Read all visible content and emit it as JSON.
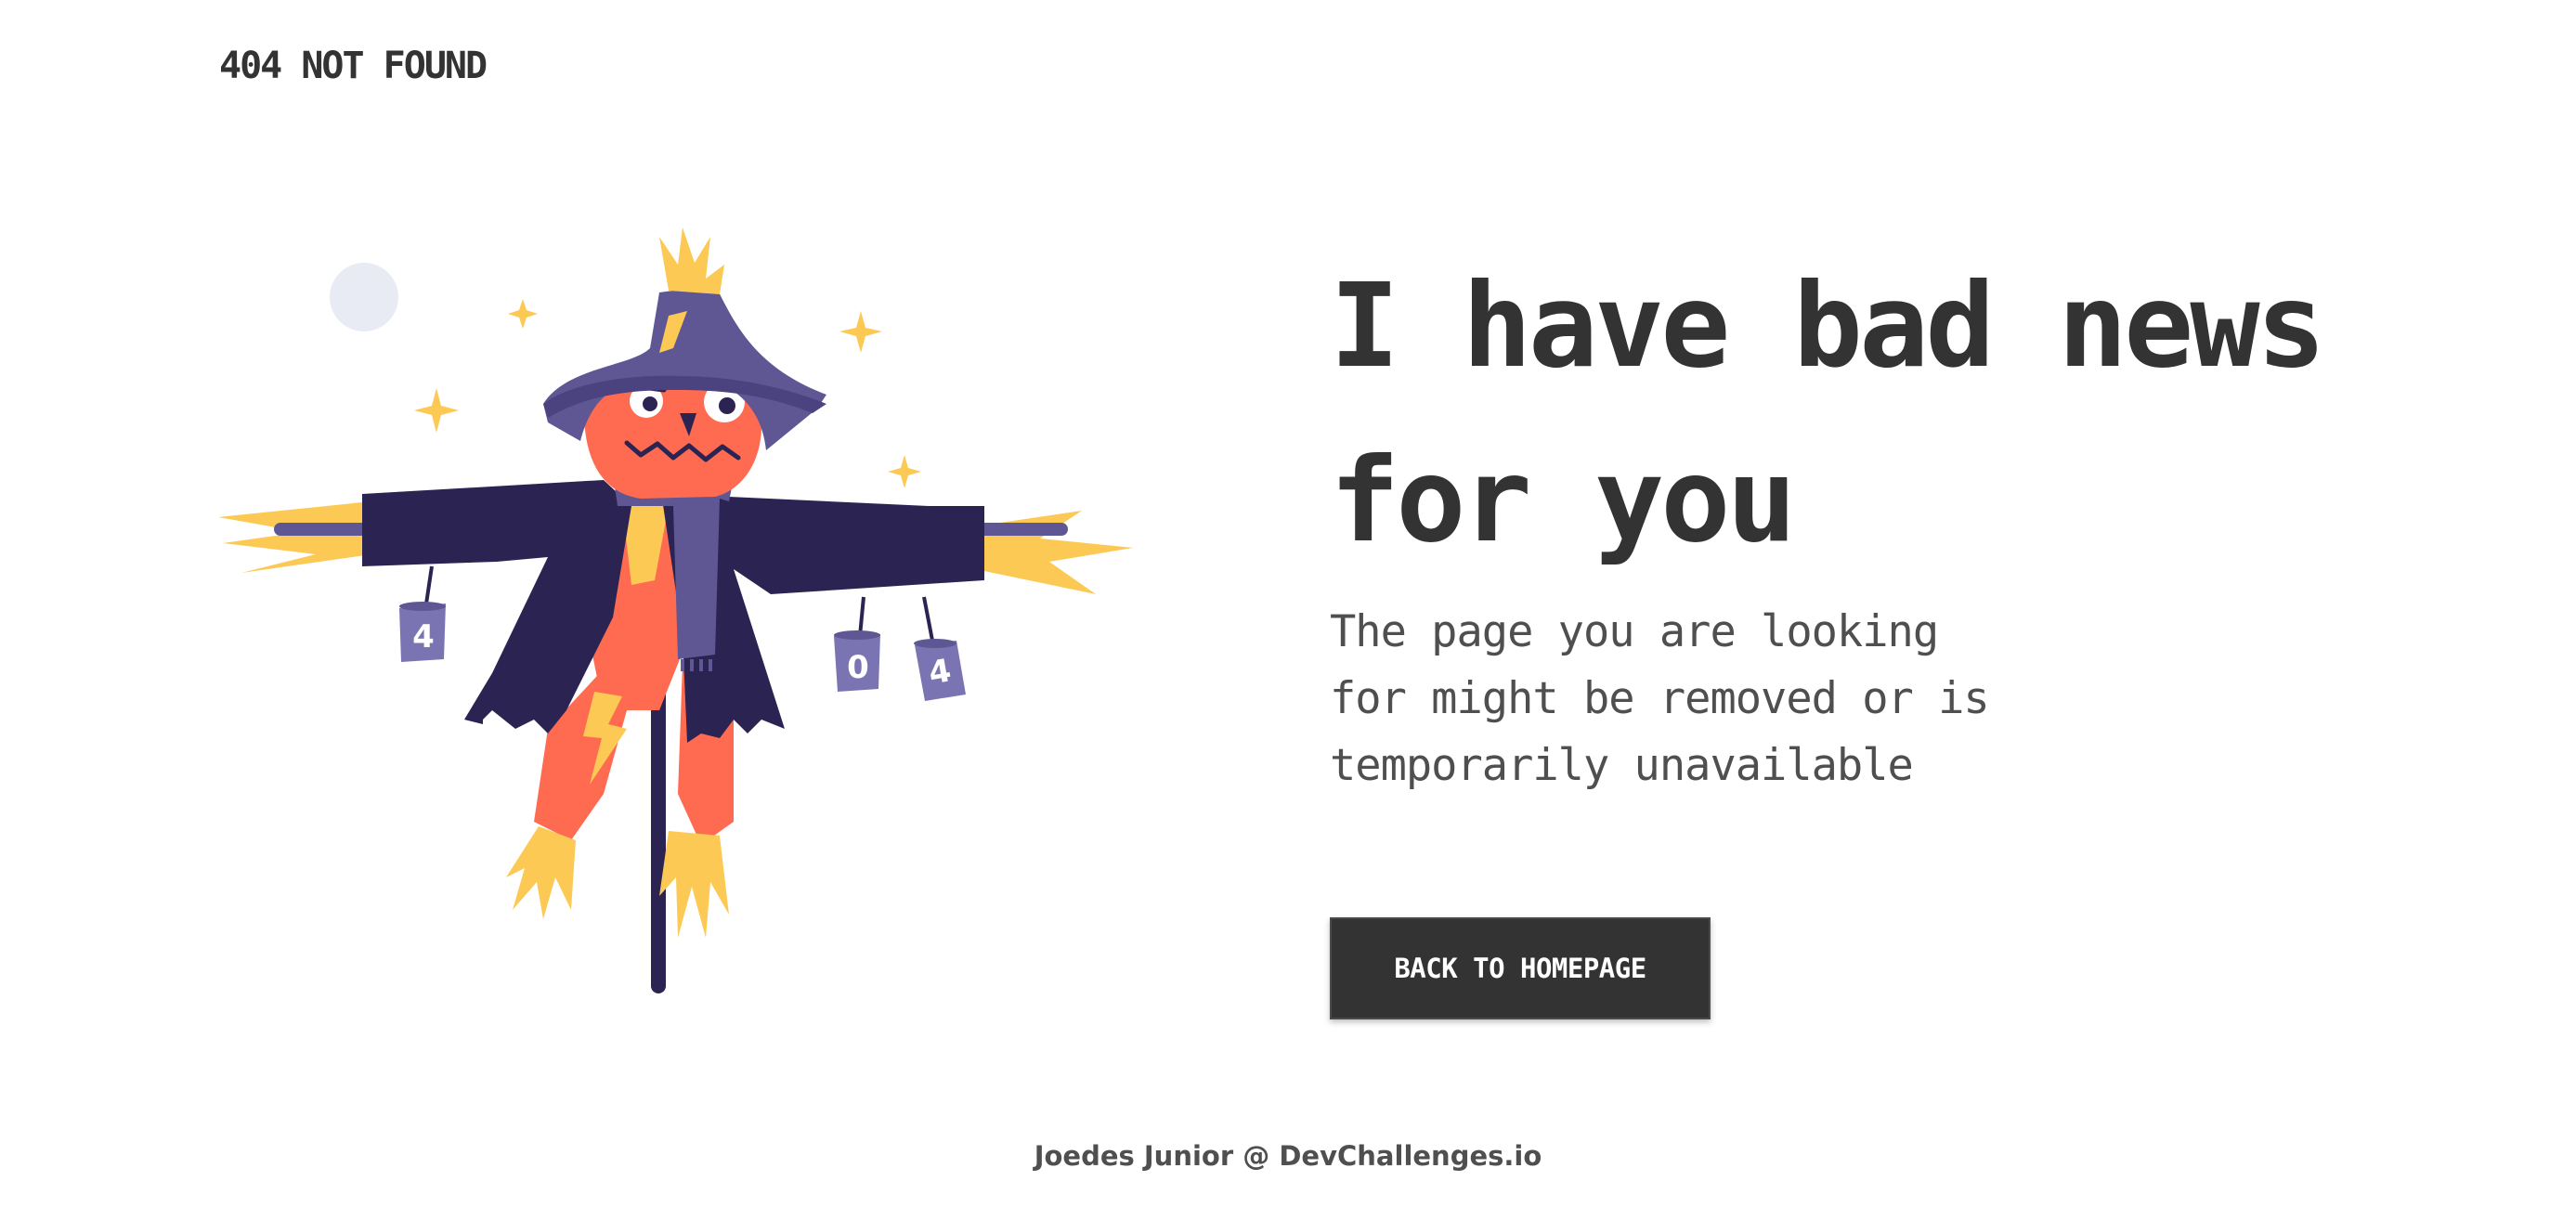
{
  "brand": {
    "label": "404 NOT FOUND"
  },
  "hero": {
    "headline_line1": "I have bad news",
    "headline_line2": "for you",
    "message_line1": "The page you are looking",
    "message_line2": "for might be removed or is",
    "message_line3": "temporarily unavailable"
  },
  "illustration": {
    "can_left_label": "4",
    "can_middle_label": "0",
    "can_right_label": "4"
  },
  "cta": {
    "label": "BACK TO HOMEPAGE"
  },
  "footer": {
    "author": "Joedes Junior",
    "separator": "@",
    "site": "DevChallenges.io"
  },
  "colors": {
    "text": "#333333",
    "muted_text": "#4f4f4f",
    "button_bg": "#333333",
    "coat": "#2b2453",
    "hat": "#5e5794",
    "face": "#ff6b51",
    "straw": "#fcc954"
  }
}
